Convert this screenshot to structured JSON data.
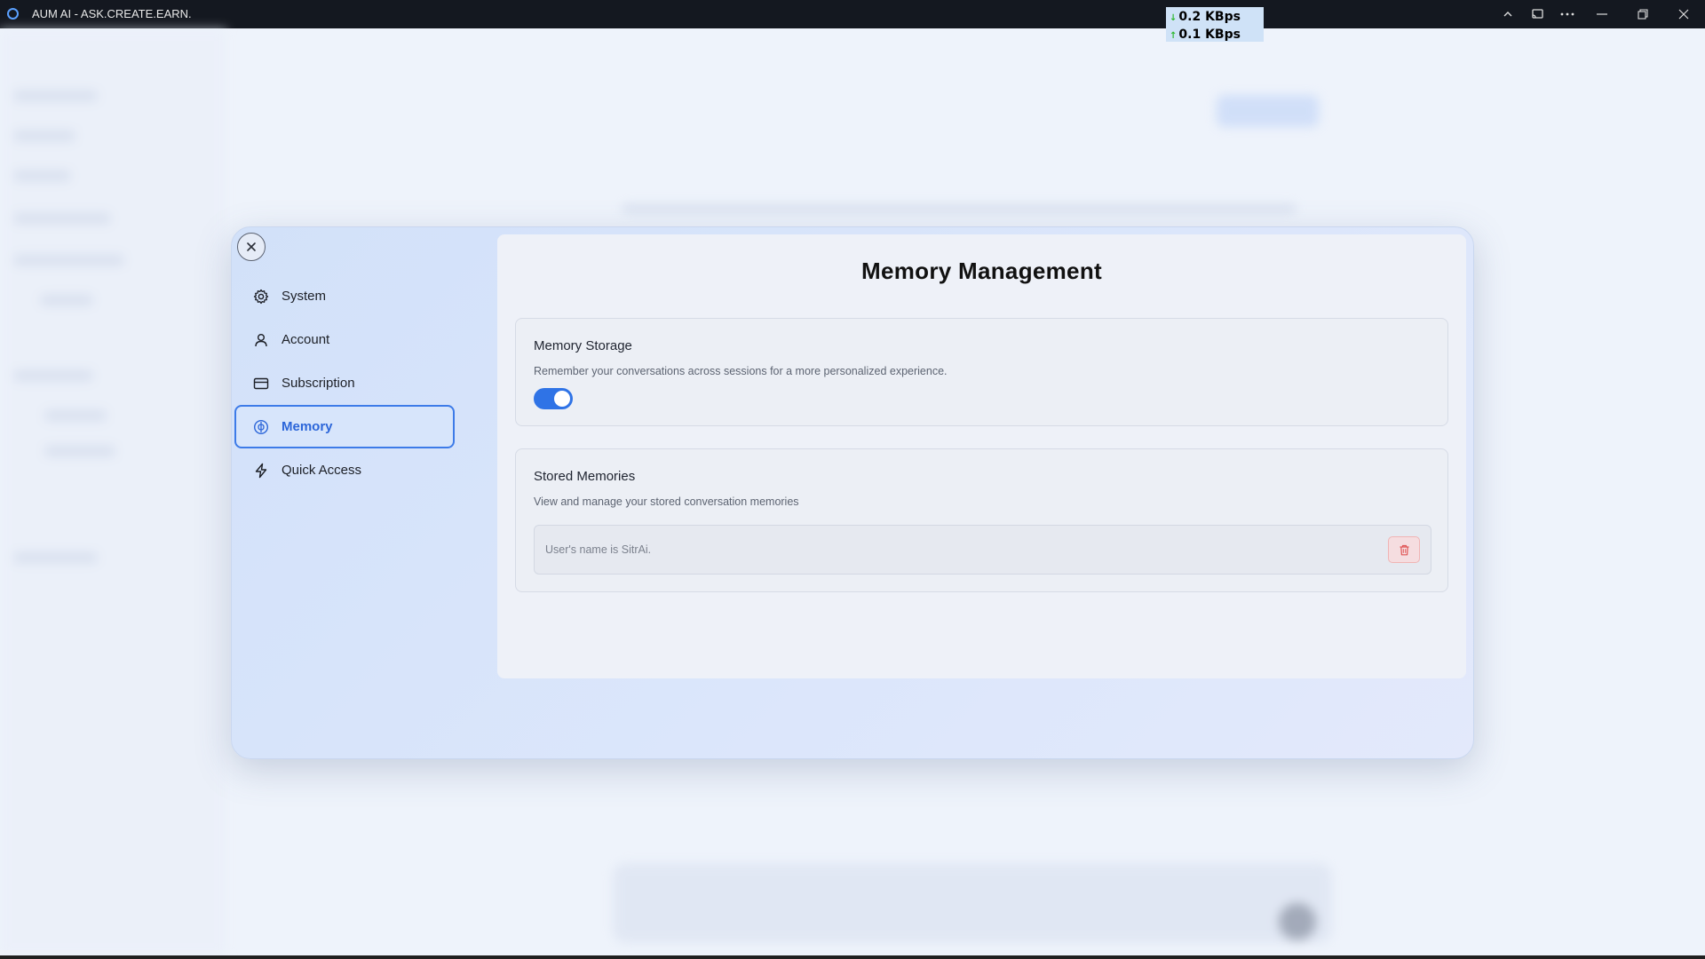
{
  "window": {
    "title": "AUM AI - ASK.CREATE.EARN.",
    "net_down": "0.2 KBps",
    "net_up": "0.1 KBps",
    "controls": [
      "chevron-up",
      "cast",
      "more",
      "minimize",
      "restore",
      "close"
    ]
  },
  "settings": {
    "nav": [
      {
        "label": "System",
        "icon": "gear-icon"
      },
      {
        "label": "Account",
        "icon": "user-icon"
      },
      {
        "label": "Subscription",
        "icon": "card-icon"
      },
      {
        "label": "Memory",
        "icon": "brain-icon",
        "active": true
      },
      {
        "label": "Quick Access",
        "icon": "bolt-icon"
      }
    ],
    "page_title": "Memory Management",
    "memory_storage": {
      "heading": "Memory Storage",
      "description": "Remember your conversations across sessions for a more personalized experience.",
      "enabled": true
    },
    "stored_memories": {
      "heading": "Stored Memories",
      "description": "View and manage your stored conversation memories",
      "items": [
        "User's name is SitrAi."
      ]
    }
  },
  "colors": {
    "accent": "#2f73e6",
    "active_nav_border": "#3d7be8",
    "danger": "#e05555"
  }
}
